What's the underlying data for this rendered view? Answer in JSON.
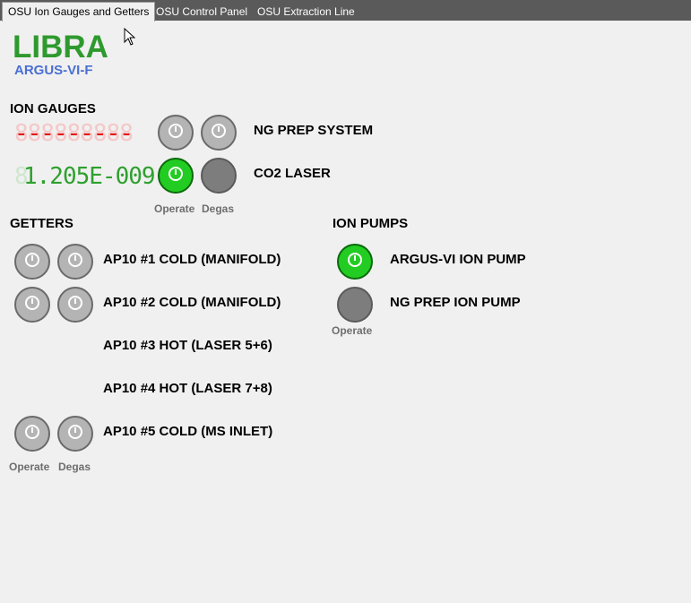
{
  "tabs": [
    {
      "label": "OSU Ion Gauges and Getters",
      "active": true
    },
    {
      "label": "OSU Control Panel",
      "active": false
    },
    {
      "label": "OSU Extraction Line",
      "active": false
    }
  ],
  "header": {
    "title": "LIBRA",
    "subtitle": "ARGUS-VI-F"
  },
  "colors": {
    "on": "#22cc22",
    "idle": "#b4b4b4",
    "off": "#7d7d7d",
    "title": "#2e9a2e",
    "subtitle": "#4a6fd4",
    "error_display": "#e10000",
    "value_display": "#2ea02e"
  },
  "ion_gauges": {
    "heading": "ION GAUGES",
    "rows": [
      {
        "display": "---------",
        "display_state": "error",
        "label": "NG PREP SYSTEM",
        "operate": "idle",
        "degas": "idle"
      },
      {
        "display": "1.205E-009",
        "display_state": "ok",
        "label": "CO2 LASER",
        "operate": "on",
        "degas": "off"
      }
    ],
    "captions": {
      "operate": "Operate",
      "degas": "Degas"
    }
  },
  "getters": {
    "heading": "GETTERS",
    "rows": [
      {
        "label": "AP10 #1 COLD (MANIFOLD)",
        "has_buttons": true,
        "operate": "idle",
        "degas": "idle"
      },
      {
        "label": "AP10 #2 COLD (MANIFOLD)",
        "has_buttons": true,
        "operate": "idle",
        "degas": "idle"
      },
      {
        "label": "AP10 #3 HOT (LASER 5+6)",
        "has_buttons": false
      },
      {
        "label": "AP10 #4 HOT (LASER 7+8)",
        "has_buttons": false
      },
      {
        "label": "AP10 #5 COLD (MS INLET)",
        "has_buttons": true,
        "operate": "idle",
        "degas": "idle"
      }
    ],
    "captions": {
      "operate": "Operate",
      "degas": "Degas"
    }
  },
  "ion_pumps": {
    "heading": "ION PUMPS",
    "rows": [
      {
        "label": "ARGUS-VI ION PUMP",
        "operate": "on"
      },
      {
        "label": "NG PREP ION PUMP",
        "operate": "off"
      }
    ],
    "captions": {
      "operate": "Operate"
    }
  },
  "icons": {
    "power": "power-icon",
    "cursor": "mouse-cursor-icon"
  }
}
